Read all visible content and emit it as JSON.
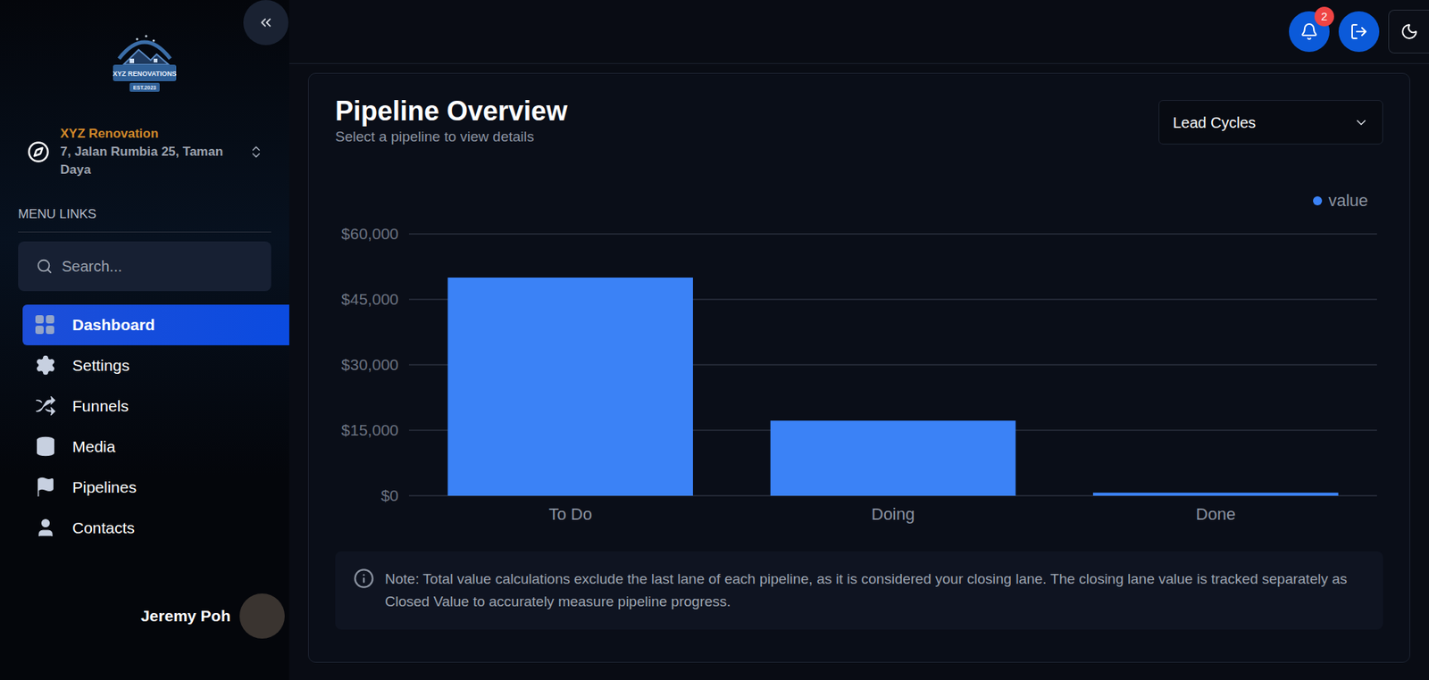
{
  "sidebar": {
    "logo": {
      "title": "XYZ RENOVATIONS",
      "subtitle": "EST.2023"
    },
    "company": {
      "name": "XYZ Renovation",
      "address": "7, Jalan Rumbia 25, Taman Daya"
    },
    "section_label": "MENU LINKS",
    "search": {
      "placeholder": "Search..."
    },
    "items": [
      {
        "label": "Dashboard",
        "selected": true
      },
      {
        "label": "Settings",
        "selected": false
      },
      {
        "label": "Funnels",
        "selected": false
      },
      {
        "label": "Media",
        "selected": false
      },
      {
        "label": "Pipelines",
        "selected": false
      },
      {
        "label": "Contacts",
        "selected": false
      }
    ],
    "user": {
      "name": "Jeremy Poh"
    }
  },
  "header": {
    "notifications": "2"
  },
  "card": {
    "title": "Pipeline Overview",
    "subtitle": "Select a pipeline to view details",
    "dropdown": "Lead Cycles",
    "chart": {
      "legend": "value",
      "y_ticks": [
        "$60,000",
        "$45,000",
        "$30,000",
        "$15,000",
        "$0"
      ],
      "y_max": 60000,
      "categories": [
        "To Do",
        "Doing",
        "Done"
      ],
      "series": [
        {
          "name": "value",
          "values": [
            50000,
            17200,
            700
          ]
        }
      ]
    },
    "note": "Note: Total value calculations exclude the last lane of each pipeline, as it is considered your closing lane. The closing lane value is tracked separately as Closed Value to accurately measure pipeline progress."
  }
}
